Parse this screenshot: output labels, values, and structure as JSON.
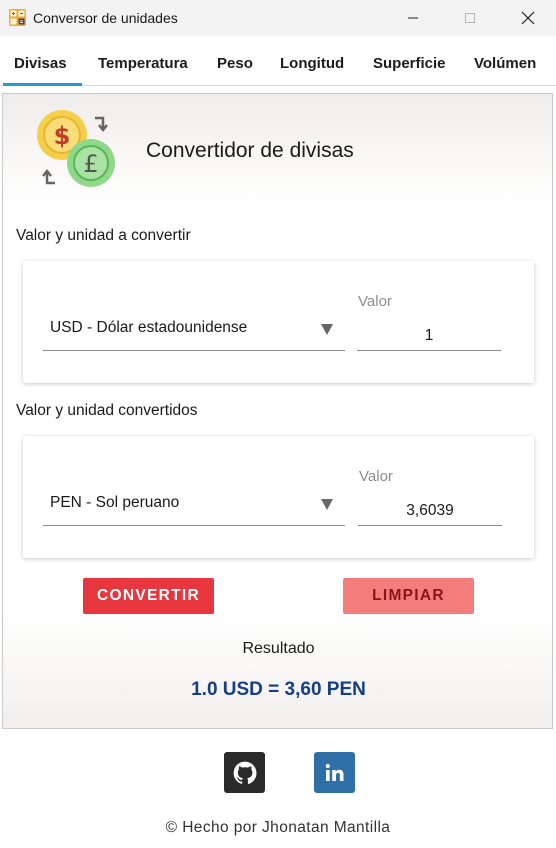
{
  "window": {
    "title": "Conversor de unidades"
  },
  "tabs": [
    {
      "label": "Divisas",
      "active": true
    },
    {
      "label": "Temperatura",
      "active": false
    },
    {
      "label": "Peso",
      "active": false
    },
    {
      "label": "Longitud",
      "active": false
    },
    {
      "label": "Superficie",
      "active": false
    },
    {
      "label": "Volúmen",
      "active": false
    }
  ],
  "header": {
    "title": "Convertidor de divisas",
    "icon": "currency-exchange-icon"
  },
  "input_section": {
    "label": "Valor y unidad a convertir",
    "unit": "USD - Dólar estadounidense",
    "value_caption": "Valor",
    "value": "1"
  },
  "output_section": {
    "label": "Valor y unidad convertidos",
    "unit": "PEN - Sol peruano",
    "value_caption": "Valor",
    "value": "3,6039"
  },
  "buttons": {
    "convert": "CONVERTIR",
    "clear": "LIMPIAR"
  },
  "result": {
    "label": "Resultado",
    "value": "1.0 USD = 3,60 PEN"
  },
  "footer": {
    "credit": "© Hecho por Jhonatan Mantilla",
    "github_icon": "github-icon",
    "linkedin_icon": "linkedin-icon"
  },
  "colors": {
    "accent_tab": "#1a9fd6",
    "convert_button": "#e8363f",
    "clear_button": "#f37d7b",
    "result_text": "#163e86",
    "github_bg": "#2a2a2a",
    "linkedin_bg": "#2e6fa7"
  }
}
